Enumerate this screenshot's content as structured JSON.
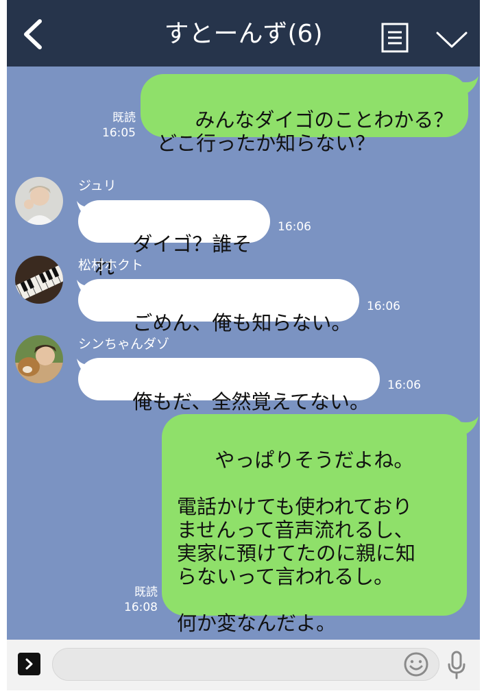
{
  "header": {
    "title": "すとーんず(6)",
    "back_icon": "chevron-left-icon",
    "menu_icon": "list-menu-icon",
    "collapse_icon": "chevron-down-icon",
    "background_color": "#26344b"
  },
  "chat": {
    "background_color": "#7b93c2",
    "my_bubble_color": "#8fe06a",
    "their_bubble_color": "#ffffff",
    "messages": [
      {
        "sender": "me",
        "text": "みんなダイゴのことわかる？\nどこ行ったか知らない？",
        "read_label": "既読",
        "time": "16:05"
      },
      {
        "sender": "ジュリ",
        "text": "ダイゴ？誰それ",
        "time": "16:06"
      },
      {
        "sender": "松村ホクト",
        "text": "ごめん、俺も知らない。",
        "time": "16:06"
      },
      {
        "sender": "シンちゃんダゾ",
        "text": "俺もだ、全然覚えてない。",
        "time": "16:06"
      },
      {
        "sender": "me",
        "text": "やっぱりそうだよね。\n\n電話かけても使われており\nませんって音声流れるし、\n実家に預けてたのに親に知\nらないって言われるし。\n\n何か変なんだよ。",
        "read_label": "既読",
        "time": "16:08"
      }
    ]
  },
  "input_bar": {
    "expand_icon": "chevron-right-icon",
    "message_value": "",
    "emoji_icon": "smiley-icon",
    "mic_icon": "microphone-icon"
  }
}
